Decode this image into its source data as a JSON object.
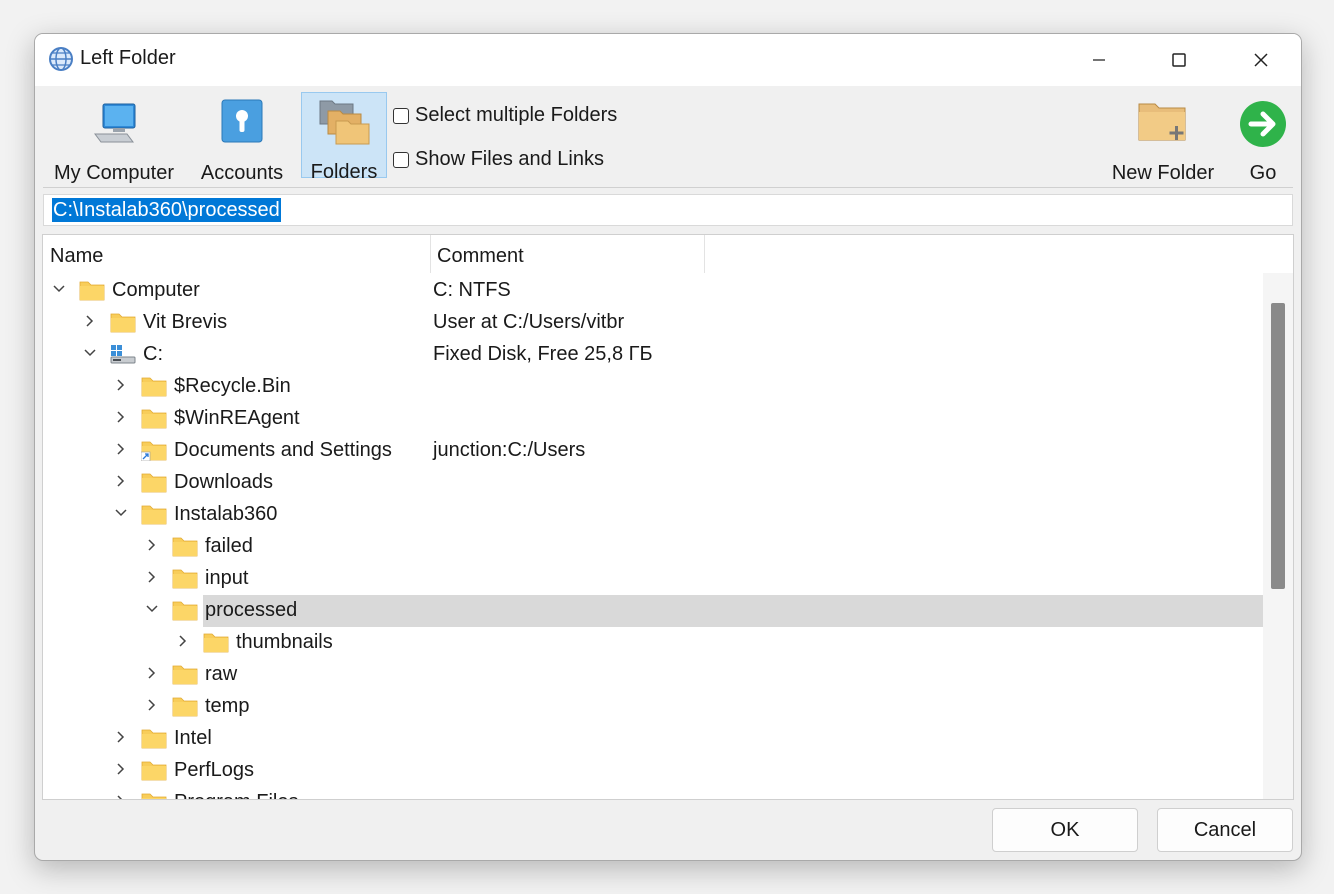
{
  "window": {
    "title": "Left Folder"
  },
  "toolbar": {
    "my_computer": "My Computer",
    "accounts": "Accounts",
    "folders": "Folders",
    "select_multiple": "Select multiple Folders",
    "show_files": "Show Files and Links",
    "new_folder": "New Folder",
    "go": "Go"
  },
  "path": {
    "value": "C:\\Instalab360\\processed"
  },
  "columns": {
    "name": "Name",
    "comment": "Comment"
  },
  "tree": [
    {
      "name": "Computer",
      "comment": "C: NTFS",
      "depth": 0,
      "state": "expanded",
      "icon": "folder-icon"
    },
    {
      "name": "Vit Brevis",
      "comment": "User at C:/Users/vitbr",
      "depth": 1,
      "state": "collapsed",
      "icon": "folder-icon"
    },
    {
      "name": "C:",
      "comment": "Fixed Disk, Free 25,8 ГБ",
      "depth": 1,
      "state": "expanded",
      "icon": "drive-icon"
    },
    {
      "name": "$Recycle.Bin",
      "comment": "",
      "depth": 2,
      "state": "collapsed",
      "icon": "folder-icon"
    },
    {
      "name": "$WinREAgent",
      "comment": "",
      "depth": 2,
      "state": "collapsed",
      "icon": "folder-icon"
    },
    {
      "name": "Documents and Settings",
      "comment": "junction:C:/Users",
      "depth": 2,
      "state": "collapsed",
      "icon": "folder-shortcut-icon"
    },
    {
      "name": "Downloads",
      "comment": "",
      "depth": 2,
      "state": "collapsed",
      "icon": "folder-icon"
    },
    {
      "name": "Instalab360",
      "comment": "",
      "depth": 2,
      "state": "expanded",
      "icon": "folder-icon"
    },
    {
      "name": "failed",
      "comment": "",
      "depth": 3,
      "state": "collapsed",
      "icon": "folder-icon"
    },
    {
      "name": "input",
      "comment": "",
      "depth": 3,
      "state": "collapsed",
      "icon": "folder-icon"
    },
    {
      "name": "processed",
      "comment": "",
      "depth": 3,
      "state": "expanded",
      "icon": "folder-icon",
      "selected": true
    },
    {
      "name": "thumbnails",
      "comment": "",
      "depth": 4,
      "state": "collapsed",
      "icon": "folder-icon"
    },
    {
      "name": "raw",
      "comment": "",
      "depth": 3,
      "state": "collapsed",
      "icon": "folder-icon"
    },
    {
      "name": "temp",
      "comment": "",
      "depth": 3,
      "state": "collapsed",
      "icon": "folder-icon"
    },
    {
      "name": "Intel",
      "comment": "",
      "depth": 2,
      "state": "collapsed",
      "icon": "folder-icon"
    },
    {
      "name": "PerfLogs",
      "comment": "",
      "depth": 2,
      "state": "collapsed",
      "icon": "folder-icon"
    },
    {
      "name": "Program Files",
      "comment": "",
      "depth": 2,
      "state": "collapsed",
      "icon": "folder-icon"
    }
  ],
  "footer": {
    "ok": "OK",
    "cancel": "Cancel"
  },
  "colors": {
    "accent": "#0078d7",
    "go": "#2fb34a",
    "folder": "#f8cd5a",
    "selection": "#d9d9d9"
  }
}
